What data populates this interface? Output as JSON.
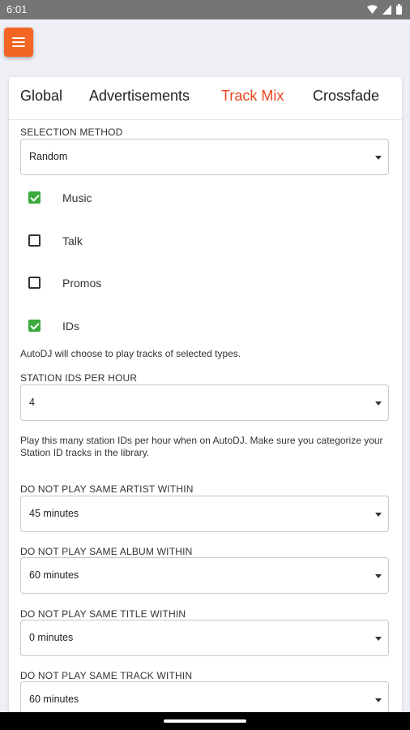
{
  "status_bar": {
    "time": "6:01"
  },
  "tabs": [
    {
      "label": "Global",
      "active": false
    },
    {
      "label": "Advertisements",
      "active": false
    },
    {
      "label": "Track Mix",
      "active": true
    },
    {
      "label": "Crossfade",
      "active": false
    }
  ],
  "selection_method": {
    "label": "SELECTION METHOD",
    "value": "Random"
  },
  "track_types": [
    {
      "label": "Music",
      "checked": true
    },
    {
      "label": "Talk",
      "checked": false
    },
    {
      "label": "Promos",
      "checked": false
    },
    {
      "label": "IDs",
      "checked": true
    }
  ],
  "track_types_help": "AutoDJ will choose to play tracks of selected types.",
  "station_ids": {
    "label": "STATION IDS PER HOUR",
    "value": "4",
    "help": "Play this many station IDs per hour when on AutoDJ. Make sure you categorize your Station ID tracks in the library."
  },
  "same_artist": {
    "label": "DO NOT PLAY SAME ARTIST WITHIN",
    "value": "45 minutes"
  },
  "same_album": {
    "label": "DO NOT PLAY SAME ALBUM WITHIN",
    "value": "60 minutes"
  },
  "same_title": {
    "label": "DO NOT PLAY SAME TITLE WITHIN",
    "value": "0 minutes"
  },
  "same_track": {
    "label": "DO NOT PLAY SAME TRACK WITHIN",
    "value": "60 minutes"
  },
  "colors": {
    "accent": "#e8461f",
    "menu_button": "#f26522",
    "checkbox_checked": "#3caa3c"
  }
}
